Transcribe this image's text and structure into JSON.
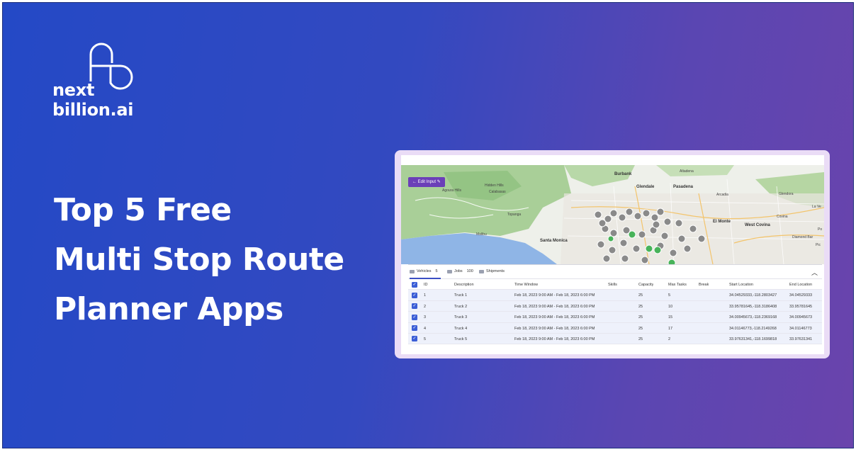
{
  "brand": {
    "line1": "next",
    "line2": "billion.ai"
  },
  "headline": {
    "line1": "Top 5 Free",
    "line2": "Multi Stop Route",
    "line3": "Planner Apps"
  },
  "colors": {
    "gradient_start": "#2449c6",
    "gradient_end": "#6a44ac",
    "card_border": "#eadcf6",
    "accent": "#6b3fb8",
    "checkbox": "#3b5ed6"
  },
  "screenshot": {
    "edit_button": "Edit Input",
    "map_labels": {
      "burbank": "Burbank",
      "altadena": "Altadena",
      "glendale": "Glendale",
      "pasadena": "Pasadena",
      "hidden_hills": "Hidden Hills",
      "agoura_hills": "Agoura Hills",
      "calabasas": "Calabasas",
      "arcadia": "Arcadia",
      "glendora": "Glendora",
      "topanga": "Topanga",
      "el_monte": "El Monte",
      "west_covina": "West Covina",
      "covina": "Covina",
      "la_verne": "La Ve",
      "malibu": "Malibu",
      "santa_monica": "Santa Monica",
      "diamond_bar": "Diamond Bar",
      "pomona": "Po",
      "pico": "Pic"
    },
    "tabs": [
      {
        "label": "Vehicles",
        "count": "5"
      },
      {
        "label": "Jobs",
        "count": "100"
      },
      {
        "label": "Shipments",
        "count": ""
      }
    ],
    "collapse_icon": "chevron-up-icon",
    "columns": [
      "ID",
      "Description",
      "Time Window",
      "Skills",
      "Capacity",
      "Max Tasks",
      "Break",
      "Start Location",
      "End Location"
    ],
    "rows": [
      {
        "id": "1",
        "description": "Truck 1",
        "time_window": "Feb 18, 2023 9:00 AM - Feb 18, 2023 6:00 PM",
        "skills": "",
        "capacity": "25",
        "max_tasks": "5",
        "break": "",
        "start": "34.04529333,-118.2803427",
        "end": "34.04529333"
      },
      {
        "id": "2",
        "description": "Truck 2",
        "time_window": "Feb 18, 2023 9:00 AM - Feb 18, 2023 6:00 PM",
        "skills": "",
        "capacity": "25",
        "max_tasks": "10",
        "break": "",
        "start": "33.95781645,-118.3186408",
        "end": "33.95781645"
      },
      {
        "id": "3",
        "description": "Truck 3",
        "time_window": "Feb 18, 2023 9:00 AM - Feb 18, 2023 6:00 PM",
        "skills": "",
        "capacity": "25",
        "max_tasks": "15",
        "break": "",
        "start": "34.00945673,-118.2369168",
        "end": "34.00945673"
      },
      {
        "id": "4",
        "description": "Truck 4",
        "time_window": "Feb 18, 2023 9:00 AM - Feb 18, 2023 6:00 PM",
        "skills": "",
        "capacity": "25",
        "max_tasks": "17",
        "break": "",
        "start": "34.01146773,-118.2149268",
        "end": "34.01146773"
      },
      {
        "id": "5",
        "description": "Truck 5",
        "time_window": "Feb 18, 2023 9:00 AM - Feb 18, 2023 6:00 PM",
        "skills": "",
        "capacity": "25",
        "max_tasks": "2",
        "break": "",
        "start": "33.97631341,-118.1699818",
        "end": "33.97631341"
      }
    ]
  }
}
